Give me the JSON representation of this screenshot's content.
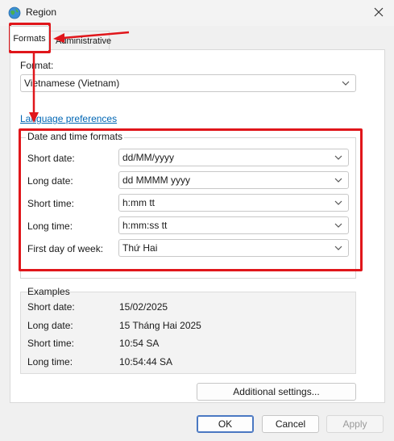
{
  "window": {
    "title": "Region"
  },
  "tabs": {
    "formats": "Formats",
    "administrative": "Administrative"
  },
  "format": {
    "label": "Format:",
    "value": "Vietnamese (Vietnam)"
  },
  "language_link": "Language preferences",
  "datetime": {
    "title": "Date and time formats",
    "rows": [
      {
        "label": "Short date:",
        "value": "dd/MM/yyyy"
      },
      {
        "label": "Long date:",
        "value": "dd MMMM yyyy"
      },
      {
        "label": "Short time:",
        "value": "h:mm tt"
      },
      {
        "label": "Long time:",
        "value": "h:mm:ss tt"
      },
      {
        "label": "First day of week:",
        "value": "Thứ Hai"
      }
    ]
  },
  "examples": {
    "title": "Examples",
    "rows": [
      {
        "label": "Short date:",
        "value": "15/02/2025"
      },
      {
        "label": "Long date:",
        "value": "15 Tháng Hai 2025"
      },
      {
        "label": "Short time:",
        "value": "10:54 SA"
      },
      {
        "label": "Long time:",
        "value": "10:54:44 SA"
      }
    ]
  },
  "buttons": {
    "additional": "Additional settings...",
    "ok": "OK",
    "cancel": "Cancel",
    "apply": "Apply"
  },
  "icons": {
    "app": "globe-icon",
    "close": "close-icon",
    "dropdown": "chevron-down-icon"
  },
  "colors": {
    "annotation": "#e0161b",
    "link": "#0066b4",
    "ok_border": "#4a78c2"
  }
}
